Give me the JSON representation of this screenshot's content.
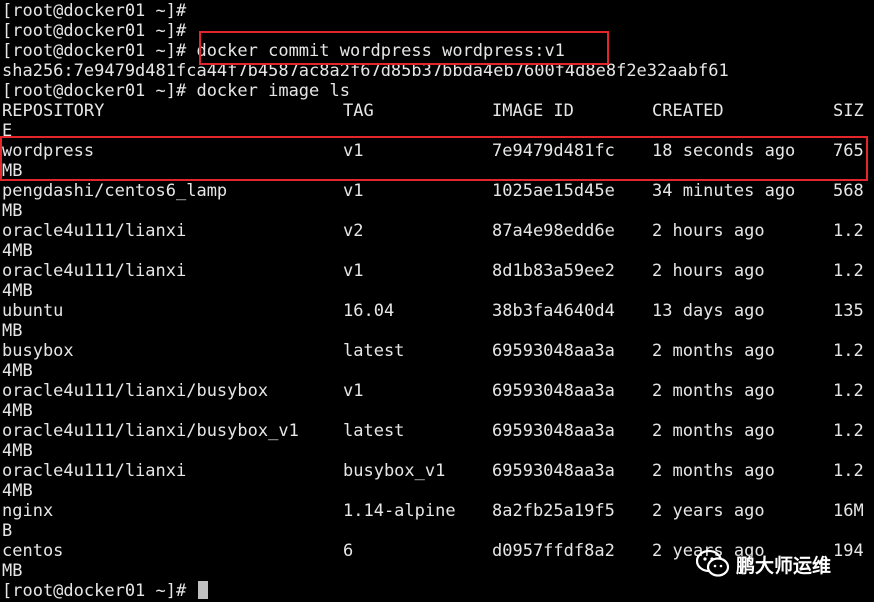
{
  "terminal": {
    "prompt_lines": [
      "[root@docker01 ~]#",
      "[root@docker01 ~]#",
      "[root@docker01 ~]# docker commit wordpress wordpress:v1",
      "sha256:7e9479d481fca44f7b4587ac8a2f67d85b37bbda4eb7600f4d8e8f2e32aabf61",
      "[root@docker01 ~]# docker image ls"
    ],
    "table_header": {
      "repository": "REPOSITORY",
      "tag": "TAG",
      "image_id": "IMAGE ID",
      "created": "CREATED",
      "size": "SIZ",
      "size_wrap": "E"
    },
    "rows": [
      {
        "repository": "wordpress",
        "tag": "v1",
        "image_id": "7e9479d481fc",
        "created": "18 seconds ago",
        "size": "765",
        "size_wrap": "MB"
      },
      {
        "repository": "pengdashi/centos6_lamp",
        "tag": "v1",
        "image_id": "1025ae15d45e",
        "created": "34 minutes ago",
        "size": "568",
        "size_wrap": "MB"
      },
      {
        "repository": "oracle4u111/lianxi",
        "tag": "v2",
        "image_id": "87a4e98edd6e",
        "created": "2 hours ago",
        "size": "1.2",
        "size_wrap": "4MB"
      },
      {
        "repository": "oracle4u111/lianxi",
        "tag": "v1",
        "image_id": "8d1b83a59ee2",
        "created": "2 hours ago",
        "size": "1.2",
        "size_wrap": "4MB"
      },
      {
        "repository": "ubuntu",
        "tag": "16.04",
        "image_id": "38b3fa4640d4",
        "created": "13 days ago",
        "size": "135",
        "size_wrap": "MB"
      },
      {
        "repository": "busybox",
        "tag": "latest",
        "image_id": "69593048aa3a",
        "created": "2 months ago",
        "size": "1.2",
        "size_wrap": "4MB"
      },
      {
        "repository": "oracle4u111/lianxi/busybox",
        "tag": "v1",
        "image_id": "69593048aa3a",
        "created": "2 months ago",
        "size": "1.2",
        "size_wrap": "4MB"
      },
      {
        "repository": "oracle4u111/lianxi/busybox_v1",
        "tag": "latest",
        "image_id": "69593048aa3a",
        "created": "2 months ago",
        "size": "1.2",
        "size_wrap": "4MB"
      },
      {
        "repository": "oracle4u111/lianxi",
        "tag": "busybox_v1",
        "image_id": "69593048aa3a",
        "created": "2 months ago",
        "size": "1.2",
        "size_wrap": "4MB"
      },
      {
        "repository": "nginx",
        "tag": "1.14-alpine",
        "image_id": "8a2fb25a19f5",
        "created": "2 years ago",
        "size": "16M",
        "size_wrap": "B"
      },
      {
        "repository": "centos",
        "tag": "6",
        "image_id": "d0957ffdf8a2",
        "created": "2 years ago",
        "size": "194",
        "size_wrap": "MB"
      }
    ],
    "final_prompt": "[root@docker01 ~]# "
  },
  "watermark": {
    "text": "鹏大师运维",
    "icon": "wechat-icon"
  },
  "colors": {
    "background": "#000000",
    "text": "#e6e6e6",
    "highlight": "#e3262b"
  }
}
